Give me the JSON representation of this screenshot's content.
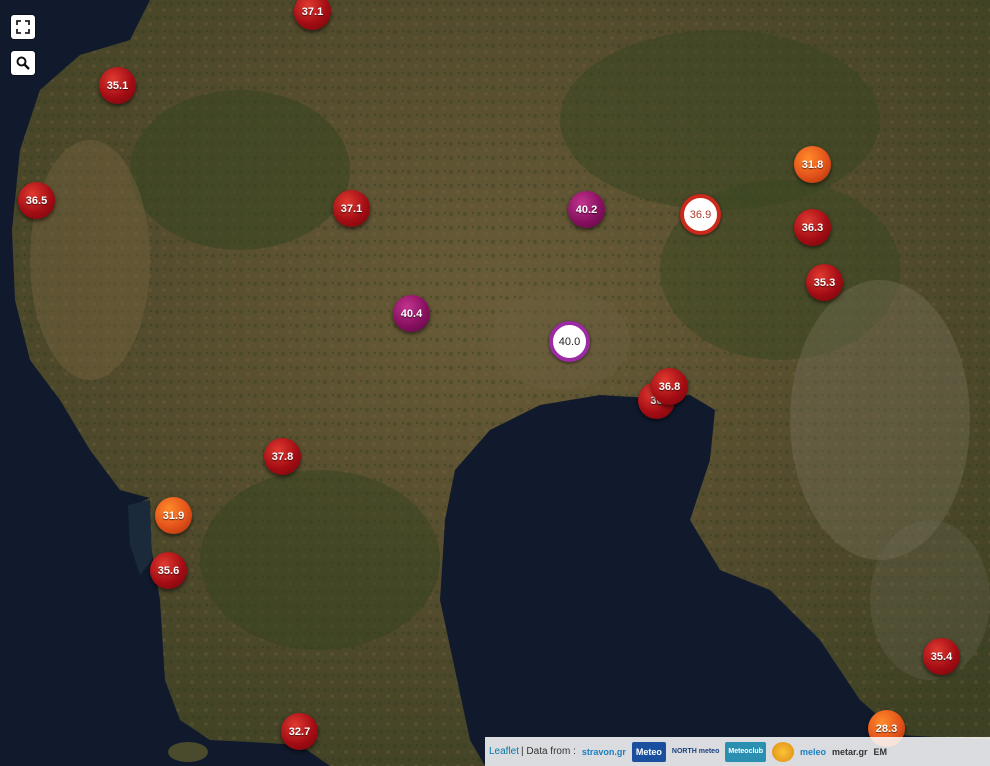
{
  "controls": {
    "fullscreen_icon": "fullscreen-icon",
    "search_icon": "search-icon"
  },
  "markers": [
    {
      "value": "37.1",
      "style": "hot"
    },
    {
      "value": "35.1",
      "style": "hot"
    },
    {
      "value": "36.5",
      "style": "hot"
    },
    {
      "value": "37.1",
      "style": "hot"
    },
    {
      "value": "40.2",
      "style": "extreme"
    },
    {
      "value": "36.9",
      "style": "ring-red"
    },
    {
      "value": "31.8",
      "style": "warm"
    },
    {
      "value": "36.3",
      "style": "hot"
    },
    {
      "value": "35.3",
      "style": "hot"
    },
    {
      "value": "40.4",
      "style": "extreme"
    },
    {
      "value": "40.0",
      "style": "ring-purple"
    },
    {
      "value": "36",
      "style": "hot"
    },
    {
      "value": "36.8",
      "style": "hot"
    },
    {
      "value": "37.8",
      "style": "hot"
    },
    {
      "value": "31.9",
      "style": "warm"
    },
    {
      "value": "35.6",
      "style": "hot"
    },
    {
      "value": "35.4",
      "style": "hot"
    },
    {
      "value": "32.7",
      "style": "hot"
    },
    {
      "value": "28.3",
      "style": "warm"
    }
  ],
  "attribution": {
    "leaflet": "Leaflet",
    "data_from": "| Data from :",
    "sources": [
      "stravon.gr",
      "Meteo",
      "NORTH meteo",
      "Meteoclub",
      "",
      "meleo",
      "metar.gr",
      "EM"
    ]
  },
  "colors": {
    "sea": "#101a2c",
    "land": "#5b5232",
    "forest": "#3b4a22",
    "hot": "#a40d14",
    "warm": "#e3521a",
    "extreme": "#881060"
  }
}
